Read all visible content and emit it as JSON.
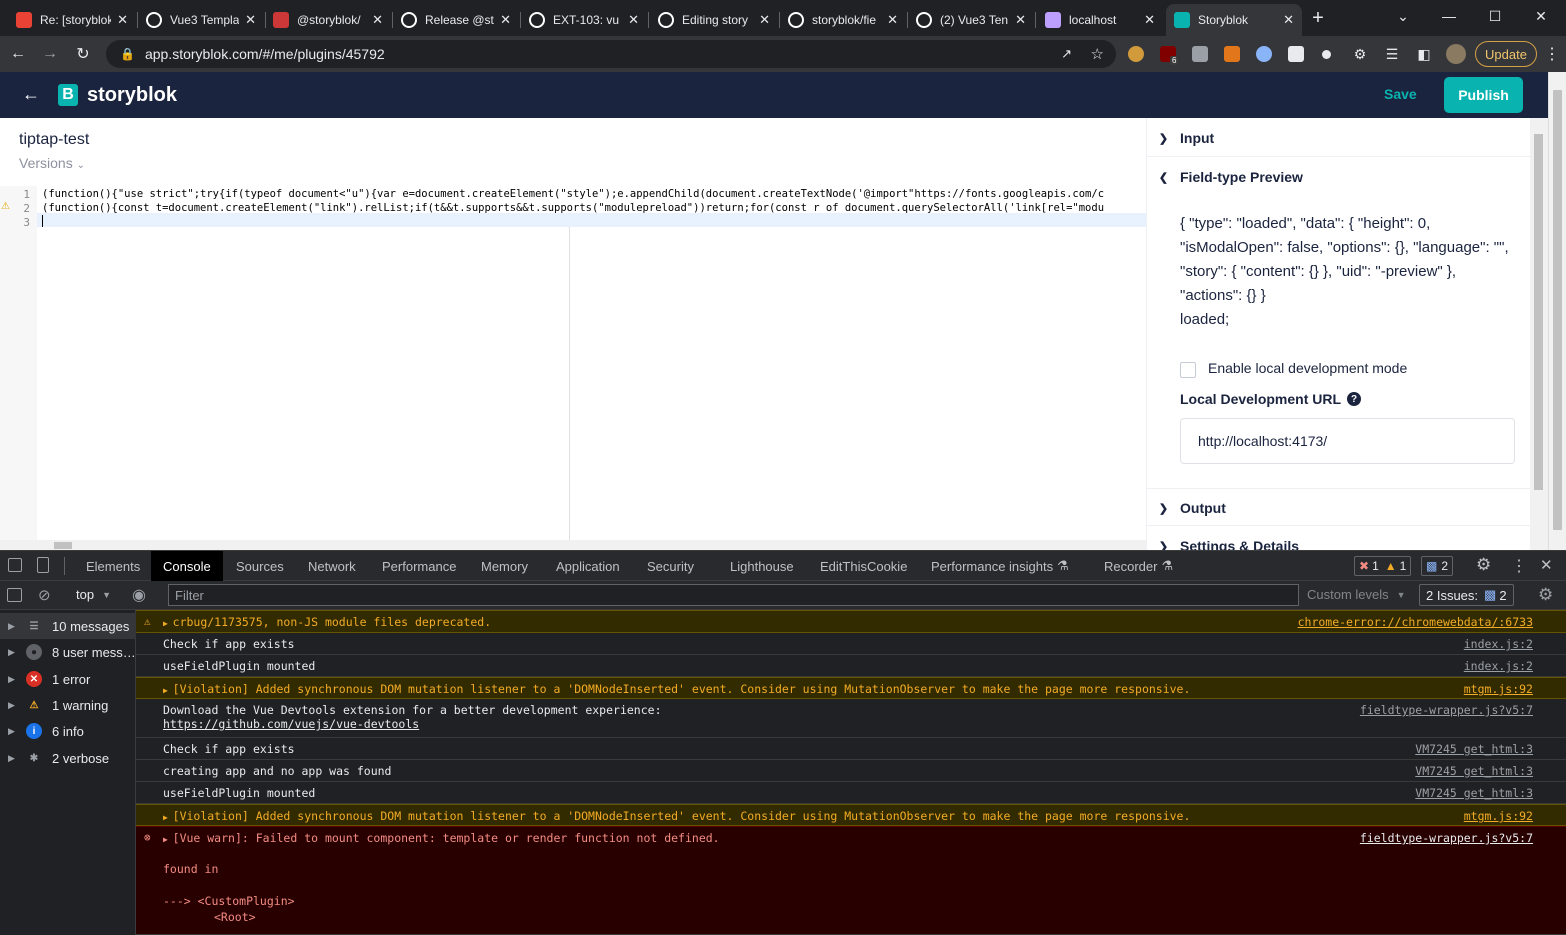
{
  "browser": {
    "tabs": [
      {
        "title": "Re: [storyblok",
        "icon": "gmail-icon",
        "color": "#ea4335"
      },
      {
        "title": "Vue3 Templa",
        "icon": "github-icon",
        "color": "#ffffff"
      },
      {
        "title": "@storyblok/",
        "icon": "npm-icon",
        "color": "#cb3837"
      },
      {
        "title": "Release @st",
        "icon": "github-icon",
        "color": "#ffffff"
      },
      {
        "title": "EXT-103: vu",
        "icon": "github-icon",
        "color": "#ffffff"
      },
      {
        "title": "Editing story",
        "icon": "github-icon",
        "color": "#ffffff"
      },
      {
        "title": "storyblok/fie",
        "icon": "github-icon",
        "color": "#ffffff"
      },
      {
        "title": "(2) Vue3 Ten",
        "icon": "github-icon",
        "color": "#ffffff"
      },
      {
        "title": "localhost",
        "icon": "vite-icon",
        "color": "#bd9fff"
      },
      {
        "title": "Storyblok",
        "icon": "storyblok-icon",
        "color": "#09b3af"
      }
    ],
    "url": "app.storyblok.com/#/me/plugins/45792",
    "update_label": "Update",
    "ext_badge": "6"
  },
  "storyblok": {
    "brand": "storyblok",
    "save_label": "Save",
    "publish_label": "Publish",
    "plugin_title": "tiptap-test",
    "versions_label": "Versions",
    "accent": "#09b3af"
  },
  "editor": {
    "line_numbers": [
      "1",
      "2",
      "3"
    ],
    "line1": "(function(){\"use strict\";try{if(typeof document<\"u\"){var e=document.createElement(\"style\");e.appendChild(document.createTextNode('@import\"https://fonts.googleapis.com/c",
    "line2": "(function(){const t=document.createElement(\"link\").relList;if(t&&t.supports&&t.supports(\"modulepreload\"))return;for(const r of document.querySelectorAll('link[rel=\"modu"
  },
  "panel": {
    "input_label": "Input",
    "preview_label": "Field-type Preview",
    "preview_json": "{ \"type\": \"loaded\", \"data\": { \"height\": 0, \"isModalOpen\": false, \"options\": {}, \"language\": \"\", \"story\": { \"content\": {} }, \"uid\": \"-preview\" }, \"actions\": {} }",
    "preview_state": "loaded;",
    "checkbox_label": "Enable local development mode",
    "url_label": "Local Development URL",
    "url_value": "http://localhost:4173/",
    "output_label": "Output",
    "settings_label": "Settings & Details"
  },
  "devtools": {
    "tabs": [
      "Elements",
      "Console",
      "Sources",
      "Network",
      "Performance",
      "Memory",
      "Application",
      "Security",
      "Lighthouse",
      "EditThisCookie",
      "Performance insights",
      "Recorder"
    ],
    "active_tab": "Console",
    "error_count": "1",
    "warning_count": "1",
    "issues_badge": "2",
    "context": "top",
    "filter_placeholder": "Filter",
    "levels_label": "Custom levels",
    "issues_label": "2 Issues:",
    "issues_count": "2",
    "sidebar": [
      {
        "label": "10 messages",
        "icon": "list-icon"
      },
      {
        "label": "8 user mess…",
        "icon": "user-icon"
      },
      {
        "label": "1 error",
        "icon": "error-icon"
      },
      {
        "label": "1 warning",
        "icon": "warning-icon"
      },
      {
        "label": "6 info",
        "icon": "info-icon"
      },
      {
        "label": "2 verbose",
        "icon": "bug-icon"
      }
    ],
    "messages": [
      {
        "level": "warning",
        "text": "crbug/1173575, non-JS module files deprecated.",
        "source": "chrome-error://chromewebdata/:6733"
      },
      {
        "level": "log",
        "text": "Check if app exists",
        "source": "index.js:2"
      },
      {
        "level": "log",
        "text": "useFieldPlugin mounted",
        "source": "index.js:2"
      },
      {
        "level": "warning",
        "text": "[Violation] Added synchronous DOM mutation listener to a 'DOMNodeInserted' event. Consider using MutationObserver to make the page more responsive.",
        "source": "mtgm.js:92"
      },
      {
        "level": "log",
        "text": "Download the Vue Devtools extension for a better development experience:",
        "link": "https://github.com/vuejs/vue-devtools",
        "source": "fieldtype-wrapper.js?v5:7"
      },
      {
        "level": "log",
        "text": "Check if app exists",
        "source": "VM7245 get_html:3"
      },
      {
        "level": "log",
        "text": "creating app and no app was found",
        "source": "VM7245 get_html:3"
      },
      {
        "level": "log",
        "text": "useFieldPlugin mounted",
        "source": "VM7245 get_html:3"
      },
      {
        "level": "warning",
        "text": "[Violation] Added synchronous DOM mutation listener to a 'DOMNodeInserted' event. Consider using MutationObserver to make the page more responsive.",
        "source": "mtgm.js:92"
      },
      {
        "level": "error",
        "text": "[Vue warn]: Failed to mount component: template or render function not defined.",
        "source": "fieldtype-wrapper.js?v5:7",
        "extra1": "found in",
        "extra2": "---> <CustomPlugin>",
        "extra3": "<Root>"
      }
    ]
  }
}
